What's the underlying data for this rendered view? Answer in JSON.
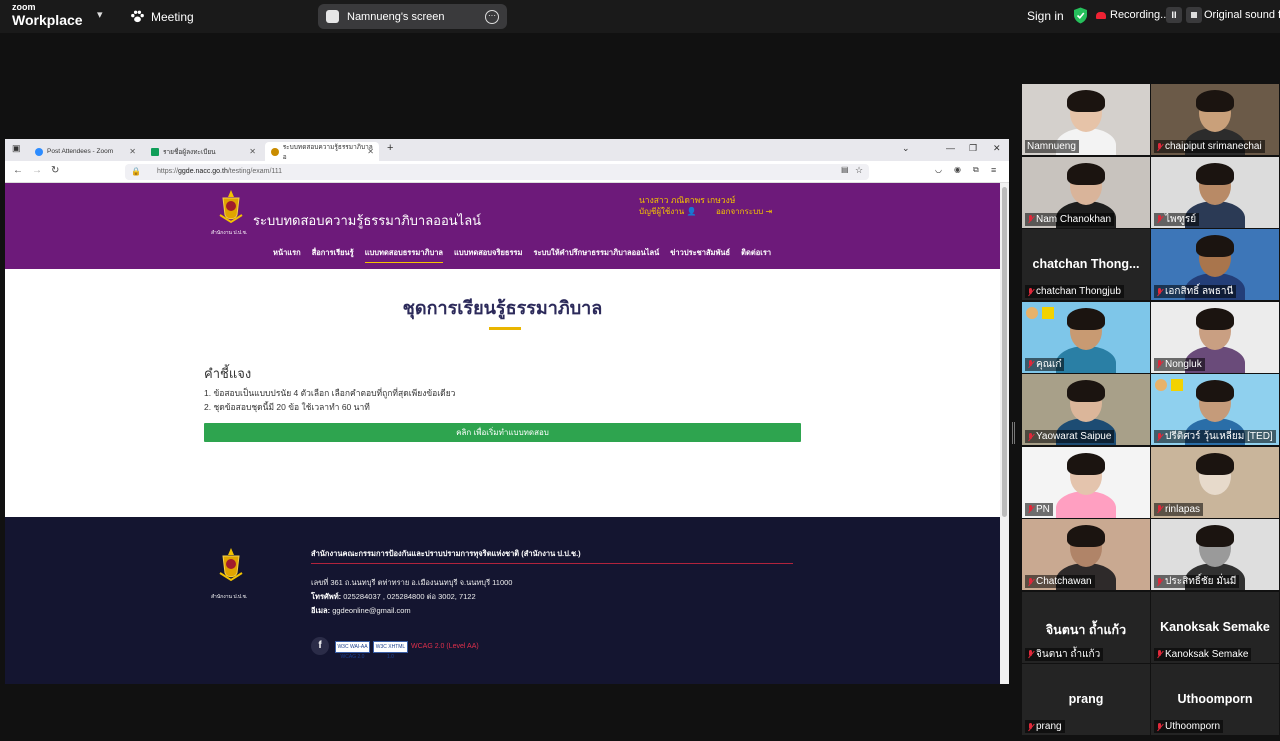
{
  "zoom": {
    "logo_top": "zoom",
    "logo_bottom": "Workplace",
    "meeting_label": "Meeting",
    "share_label": "Namnueng's screen",
    "signin": "Sign in",
    "recording": "Recording...",
    "original_sound": "Original sound f",
    "colors": {
      "bar": "#1a1a1a",
      "secure": "#26c05c",
      "record": "#e22233"
    }
  },
  "browser": {
    "tabs": [
      {
        "label": "Post Attendees - Zoom",
        "icon": "zoom-icon"
      },
      {
        "label": "รายชื่อผู้ลงทะเบียน",
        "icon": "sheet-icon"
      },
      {
        "label": "ระบบทดสอบความรู้ธรรมาภิบาลอ",
        "icon": "site-icon"
      }
    ],
    "url_prefix": "https://",
    "url_domain": "ggde.nacc.go.th",
    "url_path": "/testing/exam/111"
  },
  "site": {
    "title": "ระบบทดสอบความรู้ธรรมาภิบาลออนไลน์",
    "emblem_caption": "สำนักงาน ป.ป.ช.",
    "user_name": "นางสาว ภณิดาพร เกษวงษ์",
    "account_link": "บัญชีผู้ใช้งาน",
    "logout_link": "ออกจากระบบ",
    "menu": [
      "หน้าแรก",
      "สื่อการเรียนรู้",
      "แบบทดสอบธรรมาภิบาล",
      "แบบทดสอบจริยธรรม",
      "ระบบให้คำปรึกษาธรรมาภิบาลออนไลน์",
      "ข่าวประชาสัมพันธ์",
      "ติดต่อเรา"
    ],
    "active_menu_index": 2,
    "heading": "ชุดการเรียนรู้ธรรมาภิบาล",
    "instructions_title": "คำชี้แจง",
    "instructions": [
      "1. ข้อสอบเป็นแบบปรนัย 4 ตัวเลือก เลือกคำตอบที่ถูกที่สุดเพียงข้อเดียว",
      "2. ชุดข้อสอบชุดนี้มี 20 ข้อ ใช้เวลาทำ 60 นาที"
    ],
    "start_button": "คลิก เพื่อเริ่มทำแบบทดสอบ",
    "footer": {
      "org": "สำนักงานคณะกรรมการป้องกันและปราบปรามการทุจริตแห่งชาติ (สำนักงาน ป.ป.ช.)",
      "address": "เลขที่ 361 ถ.นนทบุรี ตท่าทราย อ.เมืองนนทบุรี จ.นนทบุรี 11000",
      "tel_label": "โทรศัพท์:",
      "tel": " 025284037 , 025284800 ต่อ 3002, 7122",
      "email_label": "อีเมล:",
      "email": " ggdeonline@gmail.com",
      "badge1": "W3C WAI-AA WCAG 2.0",
      "badge2": "W3C XHTML 1.0",
      "wcag": "WCAG 2.0 (Level AA)"
    }
  },
  "participants": [
    {
      "name": "Namnueng",
      "video": true,
      "bg": "#d4d0cc",
      "skin": "#e6c3a8",
      "shirt": "#f3f3f3",
      "speaking": true,
      "muted": false
    },
    {
      "name": "chaipiput srimanechai",
      "video": true,
      "bg": "#6b5a48",
      "skin": "#c9a07a",
      "shirt": "#2c2c2c",
      "muted": true
    },
    {
      "name": "Nam Chanokhan",
      "video": true,
      "bg": "#c8c3be",
      "skin": "#d9b49a",
      "shirt": "#1e1e1e",
      "muted": true
    },
    {
      "name": "ไพฑูรย์",
      "video": true,
      "bg": "#dcdcdc",
      "skin": "#b88a66",
      "shirt": "#2b3a55",
      "muted": true
    },
    {
      "name": "chatchan Thongjub",
      "video": false,
      "display": "chatchan  Thong...",
      "muted": true
    },
    {
      "name": "เอกสิทธิ์ ลพธานี",
      "video": true,
      "bg": "#3d76b8",
      "skin": "#a9754c",
      "shirt": "#233e78",
      "muted": true
    },
    {
      "name": "คุณเก๋",
      "video": true,
      "bg": "#7ec6e9",
      "skin": "#c89a72",
      "shirt": "#2a7fa5",
      "muted": true,
      "icons": true
    },
    {
      "name": "Nongluk",
      "video": true,
      "bg": "#ececec",
      "skin": "#c99f82",
      "shirt": "#6a4b7a",
      "muted": true
    },
    {
      "name": "Yaowarat Saipue",
      "video": true,
      "bg": "#a8a089",
      "skin": "#dbb69a",
      "shirt": "#1d4c73",
      "muted": true
    },
    {
      "name": "ปรีติศวร์ วุ้นเหลี่ยม [TED]",
      "video": true,
      "bg": "#8fd0ee",
      "skin": "#c59b7a",
      "shirt": "#2a6ea8",
      "muted": true,
      "icons": true
    },
    {
      "name": "PN",
      "video": true,
      "bg": "#f4f4f4",
      "skin": "#e4c4ad",
      "shirt": "#ff9fc1",
      "muted": true
    },
    {
      "name": "rinlapas",
      "video": true,
      "bg": "#c9b59b",
      "skin": "#e7dacb",
      "shirt": "#c9b59b",
      "muted": true
    },
    {
      "name": "Chatchawan",
      "video": true,
      "bg": "#c9a991",
      "skin": "#b08468",
      "shirt": "#2e2a2a",
      "muted": true
    },
    {
      "name": "ประสิทธิ์ชัย มั่นมี",
      "video": true,
      "bg": "#dedede",
      "skin": "#9a9a9a",
      "shirt": "#303030",
      "muted": true
    },
    {
      "name": "จินตนา ถ้ำแก้ว",
      "video": false,
      "display": "จินตนา ถ้ำแก้ว",
      "muted": true
    },
    {
      "name": "Kanoksak Semake",
      "video": false,
      "display": "Kanoksak Semake",
      "muted": true
    },
    {
      "name": "prang",
      "video": false,
      "display": "prang",
      "muted": true
    },
    {
      "name": "Uthoomporn",
      "video": false,
      "display": "Uthoomporn",
      "muted": true
    }
  ]
}
